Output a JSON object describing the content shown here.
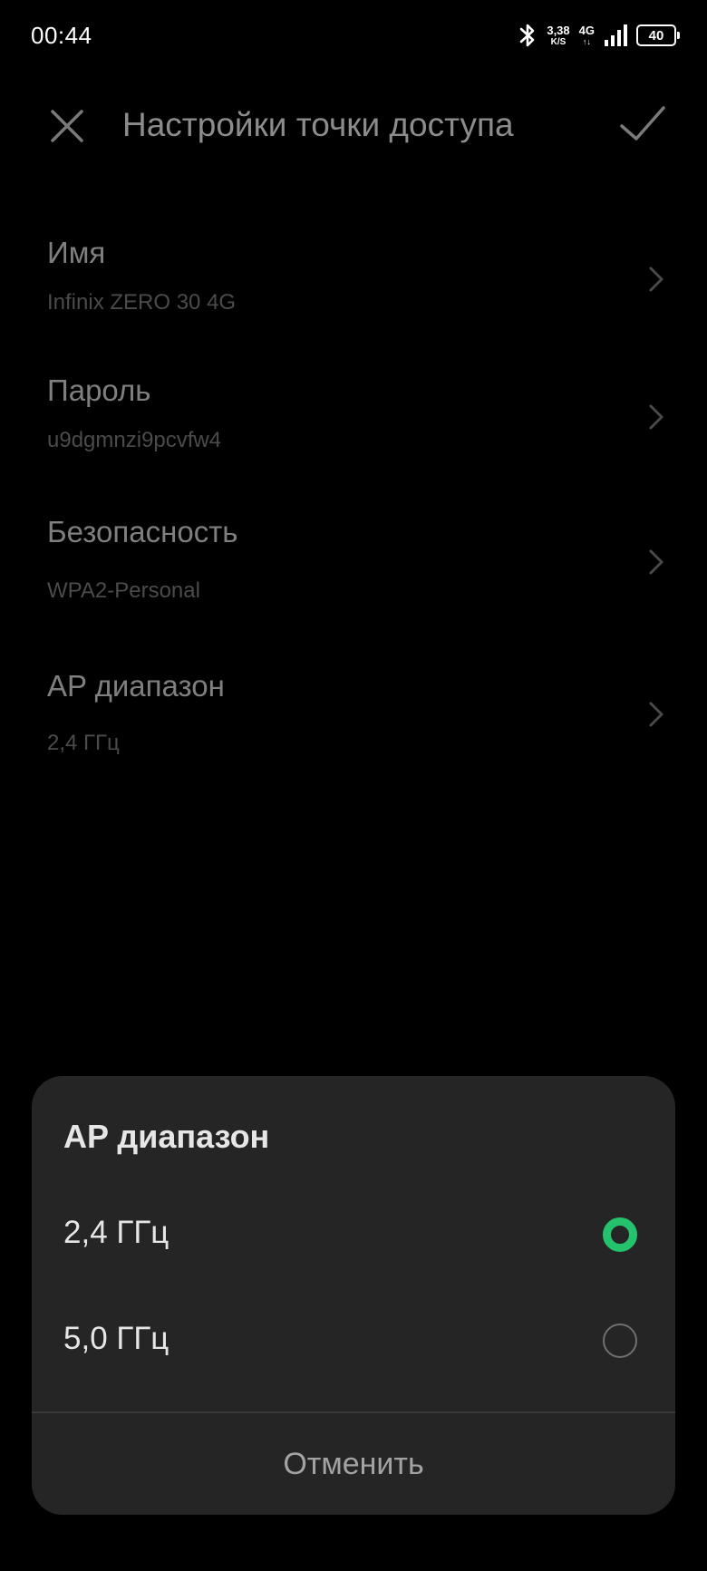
{
  "status_bar": {
    "time": "00:44",
    "speed_value": "3,38",
    "speed_unit": "K/S",
    "network_type": "4G",
    "network_arrows": "↑↓",
    "battery_level": "40",
    "icons": [
      "bluetooth-icon",
      "signal-icon",
      "battery-icon"
    ]
  },
  "app_bar": {
    "title": "Настройки точки доступа",
    "close_icon": "close-icon",
    "confirm_icon": "check-icon"
  },
  "settings": {
    "items": [
      {
        "label": "Имя",
        "value": "Infinix ZERO 30 4G"
      },
      {
        "label": "Пароль",
        "value": "u9dgmnzi9pcvfw4"
      },
      {
        "label": "Безопасность",
        "value": "WPA2-Personal"
      },
      {
        "label": "AP диапазон",
        "value": "2,4 ГГц"
      }
    ]
  },
  "sheet": {
    "title": "AP диапазон",
    "options": [
      {
        "label": "2,4 ГГц",
        "selected": true
      },
      {
        "label": "5,0 ГГц",
        "selected": false
      }
    ],
    "cancel_label": "Отменить"
  },
  "colors": {
    "background": "#000000",
    "sheet_background": "#252525",
    "accent_green": "#25c26e",
    "title_text": "#8c8c8c",
    "item_label": "#7f7f7f",
    "item_value": "#4b4b4b"
  }
}
